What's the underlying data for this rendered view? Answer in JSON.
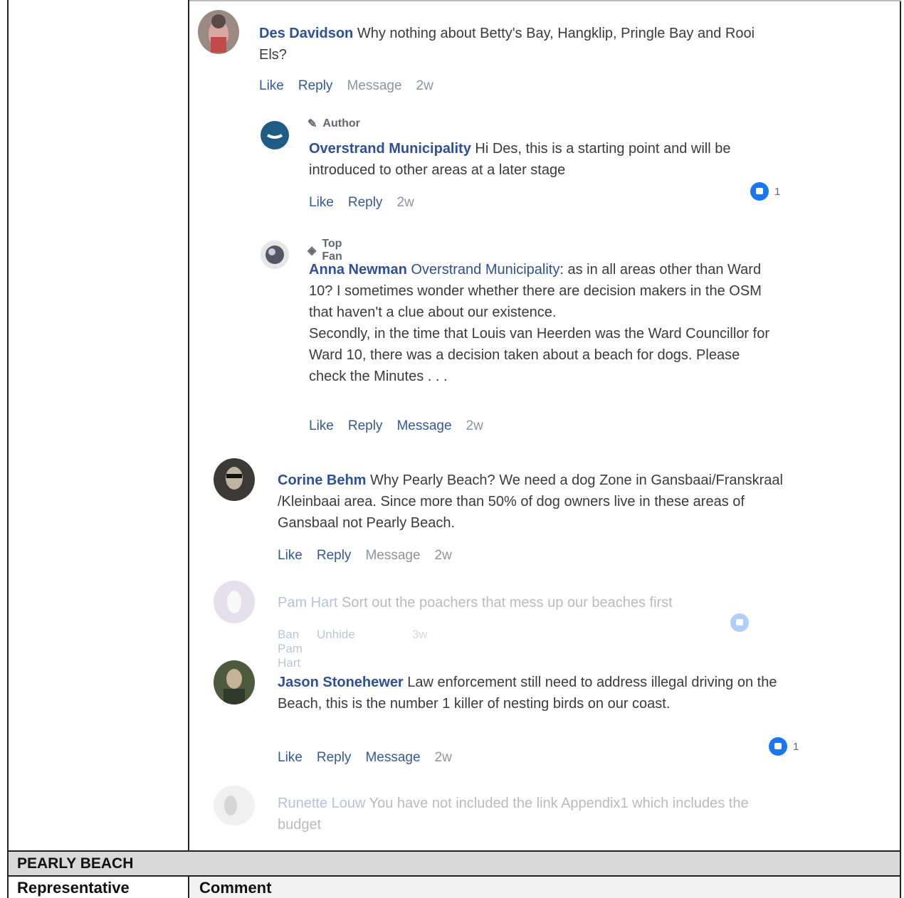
{
  "comments": [
    {
      "author": "Des Davidson",
      "text": " Why nothing about Betty's Bay, Hangklip, Pringle Bay and Rooi Els?",
      "actions": {
        "like": "Like",
        "reply": "Reply",
        "message": "Message",
        "time": "2w"
      }
    },
    {
      "badge": "Author",
      "author": "Overstrand Municipality",
      "text": " Hi Des, this is a starting point and will be introduced to other areas at a later stage",
      "actions": {
        "like": "Like",
        "reply": "Reply",
        "time": "2w"
      },
      "reactions": "1"
    },
    {
      "badge": "Top Fan",
      "author": "Anna Newman",
      "mention": " Overstrand Municipality",
      "text": ": as in all areas other than Ward 10? I sometimes wonder whether there are decision makers in the OSM that haven't a clue about our existence.",
      "text2": "Secondly, in the time that Louis van Heerden was the Ward Councillor for Ward 10, there was a decision taken about a beach for dogs. Please check the Minutes . . .",
      "actions": {
        "like": "Like",
        "reply": "Reply",
        "message": "Message",
        "time": "2w"
      }
    },
    {
      "author": "Corine Behm",
      "text": " Why Pearly Beach? We need a dog Zone in Gansbaai/Franskraal /Kleinbaai area. Since more than 50% of dog owners live in these areas of Gansbaal not Pearly Beach.",
      "actions": {
        "like": "Like",
        "reply": "Reply",
        "message": "Message",
        "time": "2w"
      }
    },
    {
      "author": "Pam Hart",
      "text": " Sort out the poachers that mess up our beaches first",
      "actions": {
        "ban": "Ban Pam Hart",
        "unhide": "Unhide",
        "time": "3w"
      }
    },
    {
      "author": "Jason Stonehewer",
      "text": " Law enforcement still need to address illegal driving on the Beach, this is the number 1 killer of nesting birds on our coast.",
      "actions": {
        "like": "Like",
        "reply": "Reply",
        "message": "Message",
        "time": "2w"
      },
      "reactions": "1"
    },
    {
      "author": "Runette Louw",
      "text": " You have not included the link Appendix1 which includes the budget"
    }
  ],
  "table": {
    "section": "PEARLY BEACH",
    "col_rep": "Representative",
    "col_comment": "Comment"
  }
}
